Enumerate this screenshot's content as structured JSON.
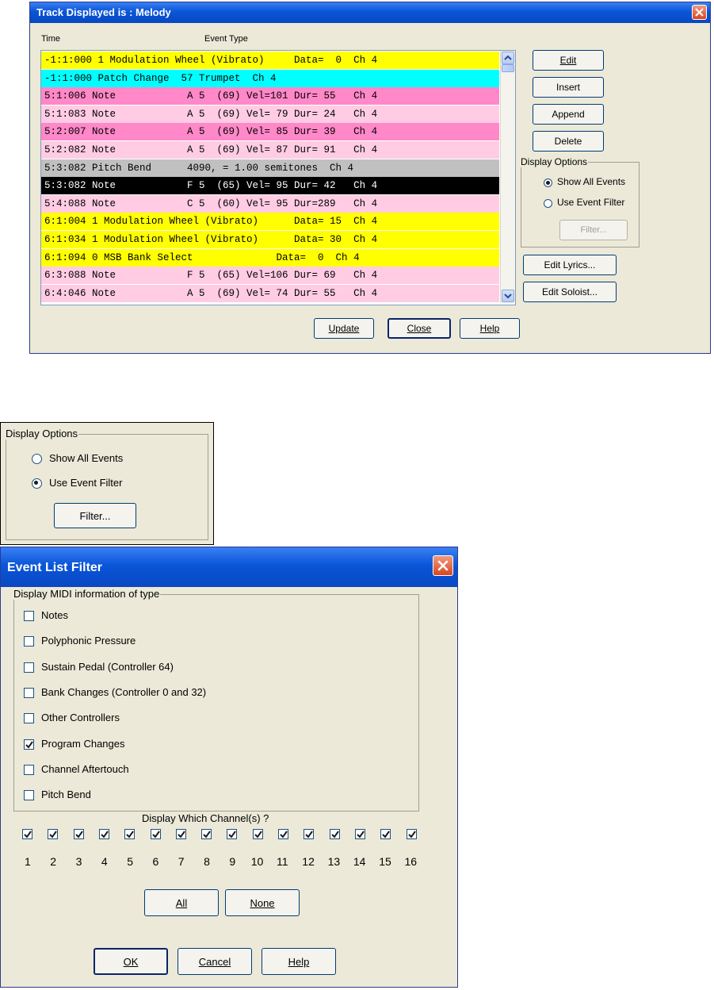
{
  "track_window": {
    "title": "Track Displayed is : Melody",
    "col_time": "Time",
    "col_event": "Event Type",
    "rows": [
      {
        "text": "-1:1:000 1 Modulation Wheel (Vibrato)     Data=  0  Ch 4",
        "bg": "#ffff00",
        "fg": "#000000"
      },
      {
        "text": "-1:1:000 Patch Change  57 Trumpet  Ch 4",
        "bg": "#00ffff",
        "fg": "#000000"
      },
      {
        "text": "5:1:006 Note            A 5  (69) Vel=101 Dur= 55   Ch 4",
        "bg": "#ff88c8",
        "fg": "#000000"
      },
      {
        "text": "5:1:083 Note            A 5  (69) Vel= 79 Dur= 24   Ch 4",
        "bg": "#ffcce4",
        "fg": "#000000"
      },
      {
        "text": "5:2:007 Note            A 5  (69) Vel= 85 Dur= 39   Ch 4",
        "bg": "#ff88c8",
        "fg": "#000000"
      },
      {
        "text": "5:2:082 Note            A 5  (69) Vel= 87 Dur= 91   Ch 4",
        "bg": "#ffcce4",
        "fg": "#000000"
      },
      {
        "text": "5:3:082 Pitch Bend      4090, = 1.00 semitones  Ch 4",
        "bg": "#c0c0c0",
        "fg": "#000000"
      },
      {
        "text": "5:3:082 Note            F 5  (65) Vel= 95 Dur= 42   Ch 4",
        "bg": "#000000",
        "fg": "#ffffff"
      },
      {
        "text": "5:4:088 Note            C 5  (60) Vel= 95 Dur=289   Ch 4",
        "bg": "#ffcce4",
        "fg": "#000000"
      },
      {
        "text": "6:1:004 1 Modulation Wheel (Vibrato)      Data= 15  Ch 4",
        "bg": "#ffff00",
        "fg": "#000000"
      },
      {
        "text": "6:1:034 1 Modulation Wheel (Vibrato)      Data= 30  Ch 4",
        "bg": "#ffff00",
        "fg": "#000000"
      },
      {
        "text": "6:1:094 0 MSB Bank Select              Data=  0  Ch 4",
        "bg": "#ffff00",
        "fg": "#000000"
      },
      {
        "text": "6:3:088 Note            F 5  (65) Vel=106 Dur= 69   Ch 4",
        "bg": "#ffcce4",
        "fg": "#000000"
      },
      {
        "text": "6:4:046 Note            A 5  (69) Vel= 74 Dur= 55   Ch 4",
        "bg": "#ffcce4",
        "fg": "#000000"
      }
    ],
    "btn_edit": "Edit",
    "btn_insert": "Insert",
    "btn_append": "Append",
    "btn_delete": "Delete",
    "display_options": {
      "label": "Display Options",
      "show_all": "Show All Events",
      "use_filter": "Use Event Filter",
      "filter": "Filter...",
      "selected": "show_all"
    },
    "btn_edit_lyrics": "Edit Lyrics...",
    "btn_edit_soloist": "Edit Soloist...",
    "btn_update": "Update",
    "btn_close": "Close",
    "btn_help": "Help"
  },
  "options_crop": {
    "label": "Display Options",
    "show_all": "Show All Events",
    "use_filter": "Use Event Filter",
    "filter": "Filter...",
    "selected": "use_filter"
  },
  "filter_window": {
    "title": "Event List Filter",
    "group_label": "Display MIDI information  of type",
    "types": [
      {
        "label": "Notes",
        "checked": false
      },
      {
        "label": "Polyphonic Pressure",
        "checked": false
      },
      {
        "label": "Sustain Pedal (Controller 64)",
        "checked": false
      },
      {
        "label": "Bank Changes (Controller 0 and 32)",
        "checked": false
      },
      {
        "label": "Other Controllers",
        "checked": false
      },
      {
        "label": "Program Changes",
        "checked": true
      },
      {
        "label": "Channel Aftertouch",
        "checked": false
      },
      {
        "label": "Pitch Bend",
        "checked": false
      }
    ],
    "channels_label": "Display Which Channel(s) ?",
    "channels": [
      "1",
      "2",
      "3",
      "4",
      "5",
      "6",
      "7",
      "8",
      "9",
      "10",
      "11",
      "12",
      "13",
      "14",
      "15",
      "16"
    ],
    "btn_all": "All",
    "btn_none": "None",
    "btn_ok": "OK",
    "btn_cancel": "Cancel",
    "btn_help": "Help"
  }
}
